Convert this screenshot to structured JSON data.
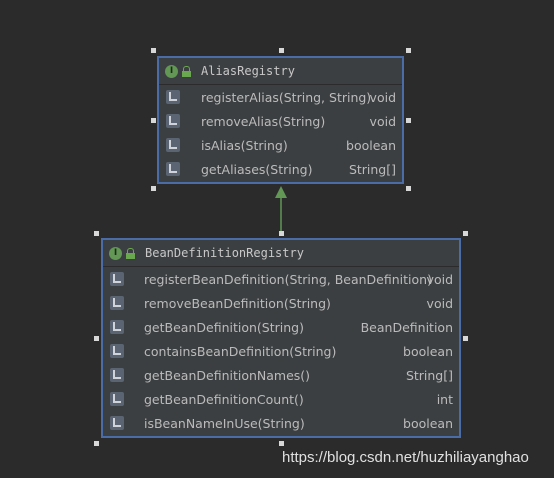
{
  "diagram": {
    "nodes": [
      {
        "name": "AliasRegistry",
        "kind_icon": "interface-icon",
        "access_icon": "lock-icon",
        "methods": [
          {
            "name": "registerAlias(String, String)",
            "returns": "void"
          },
          {
            "name": "removeAlias(String)",
            "returns": "void"
          },
          {
            "name": "isAlias(String)",
            "returns": "boolean"
          },
          {
            "name": "getAliases(String)",
            "returns": "String[]"
          }
        ]
      },
      {
        "name": "BeanDefinitionRegistry",
        "kind_icon": "interface-icon",
        "access_icon": "lock-icon",
        "methods": [
          {
            "name": "registerBeanDefinition(String, BeanDefinition)",
            "returns": "void"
          },
          {
            "name": "removeBeanDefinition(String)",
            "returns": "void"
          },
          {
            "name": "getBeanDefinition(String)",
            "returns": "BeanDefinition"
          },
          {
            "name": "containsBeanDefinition(String)",
            "returns": "boolean"
          },
          {
            "name": "getBeanDefinitionNames()",
            "returns": "String[]"
          },
          {
            "name": "getBeanDefinitionCount()",
            "returns": "int"
          },
          {
            "name": "isBeanNameInUse(String)",
            "returns": "boolean"
          }
        ]
      }
    ],
    "edges": [
      {
        "from": "BeanDefinitionRegistry",
        "to": "AliasRegistry",
        "type": "extends"
      }
    ]
  },
  "colors": {
    "background": "#2b2b2b",
    "node_fill": "#3c3f41",
    "node_border": "#4a6da7",
    "edge": "#629755",
    "interface_icon": "#629755",
    "text": "#bbbbbb"
  },
  "watermark": "https://blog.csdn.net/huzhiliayanghao"
}
